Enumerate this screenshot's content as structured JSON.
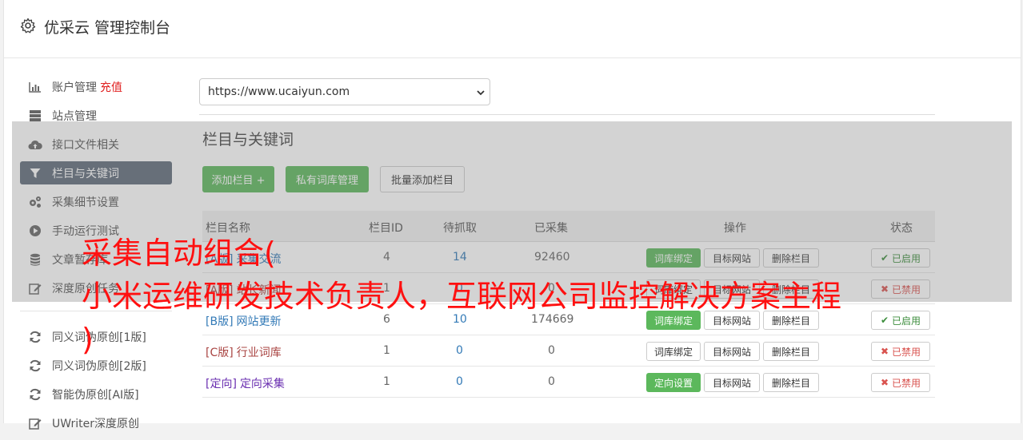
{
  "header": {
    "title": "优采云 管理控制台",
    "icon": "gear-icon"
  },
  "sidebar": {
    "recharge": "充值",
    "items": [
      {
        "label": "账户管理",
        "icon": "bar-chart-icon"
      },
      {
        "label": "站点管理",
        "icon": "server-icon"
      },
      {
        "label": "接口文件相关",
        "icon": "cloud-upload-icon"
      },
      {
        "label": "栏目与关键词",
        "icon": "filter-icon",
        "active": true
      },
      {
        "label": "采集细节设置",
        "icon": "cogs-icon"
      },
      {
        "label": "手动运行测试",
        "icon": "play-icon"
      },
      {
        "label": "文章暂存库",
        "icon": "database-icon"
      },
      {
        "label": "深度原创任务",
        "icon": "edit-icon"
      }
    ],
    "items2": [
      {
        "label": "同义词伪原创[1版]",
        "icon": "refresh-icon"
      },
      {
        "label": "同义词伪原创[2版]",
        "icon": "refresh-icon"
      },
      {
        "label": "智能伪原创[AI版]",
        "icon": "refresh-icon"
      },
      {
        "label": "UWriter深度原创",
        "icon": "edit-icon"
      }
    ]
  },
  "site_select": {
    "value": "https://www.ucaiyun.com"
  },
  "section": {
    "title": "栏目与关键词",
    "add_btn": "添加栏目 +",
    "private_btn": "私有词库管理",
    "batch_btn": "批量添加栏目"
  },
  "table": {
    "headers": {
      "name": "栏目名称",
      "id": "栏目ID",
      "pending": "待抓取",
      "collected": "已采集",
      "ops": "操作",
      "status": "状态"
    },
    "op_labels": {
      "bind": "词库绑定",
      "target": "目标网站",
      "delete": "删除栏目",
      "fixed": "定向设置"
    },
    "rows": [
      {
        "tag": "[A版]",
        "name": "采集交流",
        "id": "4",
        "pending": "14",
        "collected": "92460",
        "first_op": "词库绑定",
        "first_op_green": true,
        "status": "已启用",
        "status_on": true
      },
      {
        "tag": "[A版]",
        "name": "站长新闻",
        "id": "1",
        "pending": "0",
        "collected": "0",
        "first_op": "词库绑定",
        "first_op_green": false,
        "status": "已禁用",
        "status_on": false
      },
      {
        "tag": "[B版]",
        "name": "网站更新",
        "id": "6",
        "pending": "10",
        "collected": "174669",
        "first_op": "词库绑定",
        "first_op_green": true,
        "status": "已启用",
        "status_on": true
      },
      {
        "tag": "[C版]",
        "name": "行业词库",
        "id": "1",
        "pending": "0",
        "collected": "0",
        "first_op": "词库绑定",
        "first_op_green": false,
        "status": "已禁用",
        "status_on": false
      },
      {
        "tag": "[定向]",
        "name": "定向采集",
        "id": "1",
        "pending": "0",
        "collected": "0",
        "first_op": "定向设置",
        "first_op_green": true,
        "status": "已禁用",
        "status_on": false
      }
    ]
  },
  "watermark": {
    "line1": "采集自动组合(",
    "line2": "小米运维研发技术负责人，互联网公司监控解决方案主程",
    "line3": ")"
  },
  "colors": {
    "active_bg": "#5f6b7a",
    "green": "#5cb85c",
    "link": "#337ab7",
    "danger": "#d9534f",
    "watermark": "#ff1010"
  }
}
